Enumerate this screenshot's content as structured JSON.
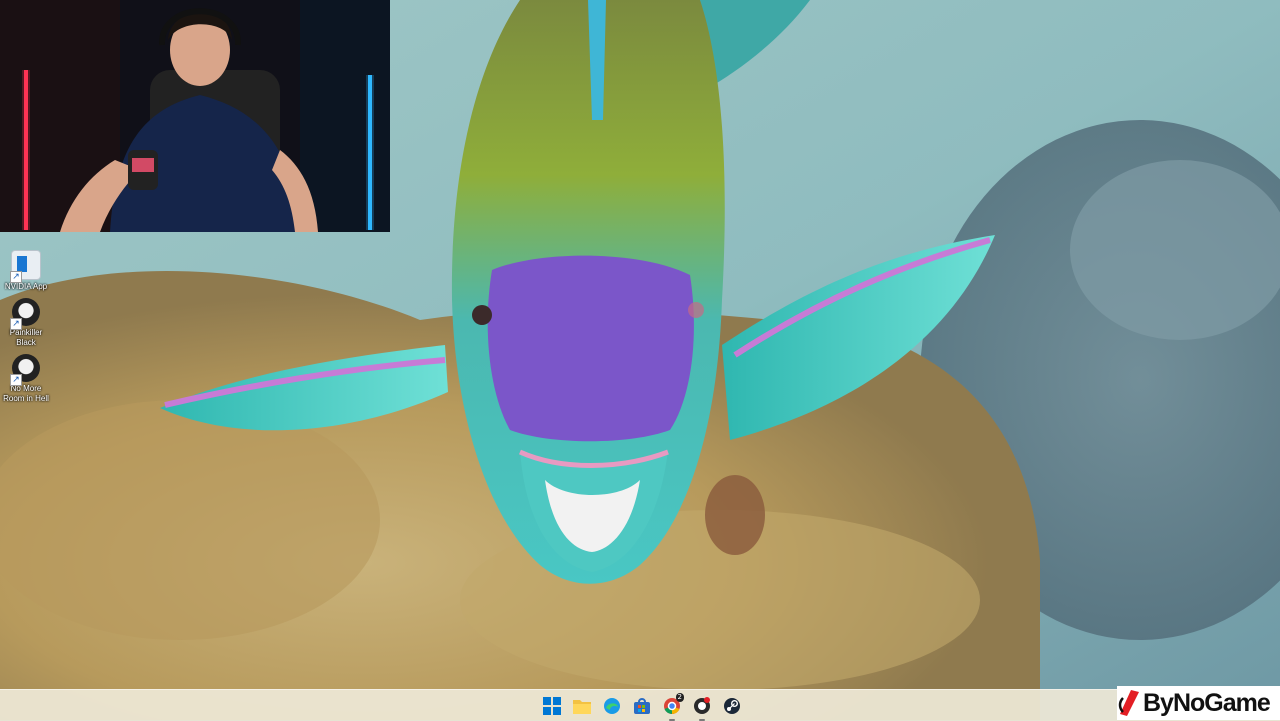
{
  "desktop": {
    "icons": [
      {
        "label": "NVIDIA App",
        "icon": "nvidia-app-icon"
      },
      {
        "label": "Painkiller Black",
        "icon": "painkiller-icon"
      },
      {
        "label": "No More Room in Hell",
        "icon": "nmrih-icon"
      }
    ]
  },
  "taskbar": {
    "apps": [
      {
        "name": "Start",
        "icon": "windows-start-icon"
      },
      {
        "name": "File Explorer",
        "icon": "folder-icon"
      },
      {
        "name": "Microsoft Edge",
        "icon": "edge-icon"
      },
      {
        "name": "Microsoft Store",
        "icon": "store-icon"
      },
      {
        "name": "Google Chrome",
        "icon": "chrome-icon",
        "badge": "2"
      },
      {
        "name": "Game client",
        "icon": "game-client-icon"
      },
      {
        "name": "Steam",
        "icon": "steam-icon"
      }
    ]
  },
  "watermark": {
    "text": "ByNoGame"
  },
  "colors": {
    "taskbar": "#eee8d6",
    "accent": "#0078d4",
    "watermark_red": "#e31e24"
  }
}
